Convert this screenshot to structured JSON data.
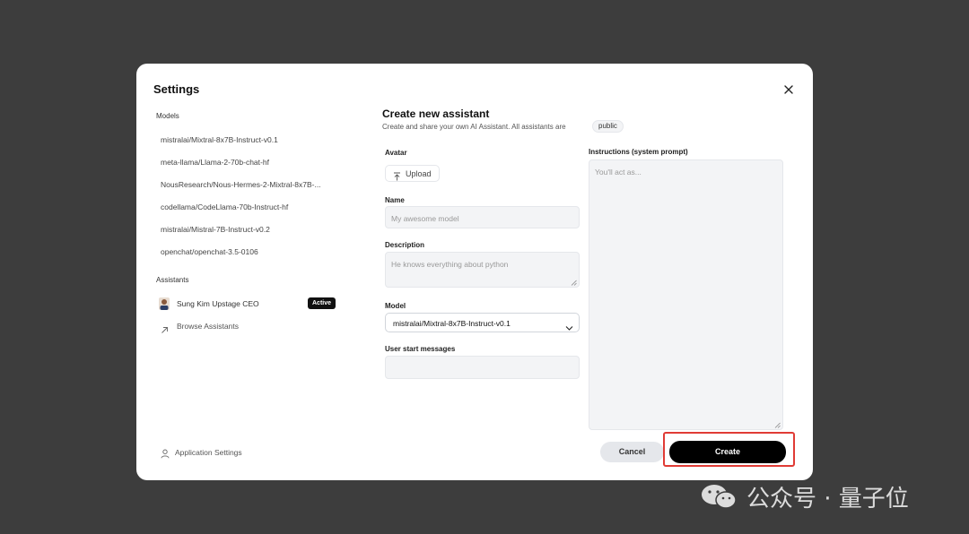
{
  "modal": {
    "title": "Settings"
  },
  "sidebar": {
    "models_label": "Models",
    "models": [
      "mistralai/Mixtral-8x7B-Instruct-v0.1",
      "meta-llama/Llama-2-70b-chat-hf",
      "NousResearch/Nous-Hermes-2-Mixtral-8x7B-...",
      "codellama/CodeLlama-70b-Instruct-hf",
      "mistralai/Mistral-7B-Instruct-v0.2",
      "openchat/openchat-3.5-0106"
    ],
    "assistants_label": "Assistants",
    "assistant": {
      "name": "Sung Kim Upstage CEO",
      "badge": "Active"
    },
    "browse_label": "Browse Assistants",
    "app_settings_label": "Application Settings"
  },
  "form": {
    "title": "Create new assistant",
    "subtitle": "Create and share your own AI Assistant. All assistants are",
    "visibility": "public",
    "avatar_label": "Avatar",
    "upload_label": "Upload",
    "name_label": "Name",
    "name_placeholder": "My awesome model",
    "description_label": "Description",
    "description_placeholder": "He knows everything about python",
    "model_label": "Model",
    "model_value": "mistralai/Mixtral-8x7B-Instruct-v0.1",
    "start_messages_label": "User start messages",
    "instructions_label": "Instructions (system prompt)",
    "instructions_placeholder": "You'll act as...",
    "cancel_label": "Cancel",
    "create_label": "Create"
  },
  "watermark": {
    "text": "公众号 · 量子位"
  },
  "colors": {
    "backdrop": "#3d3d3d",
    "modal_bg": "#ffffff",
    "input_bg": "#f3f4f6",
    "primary_button": "#000000",
    "highlight_border": "#e03b35",
    "active_badge": "#111111"
  }
}
